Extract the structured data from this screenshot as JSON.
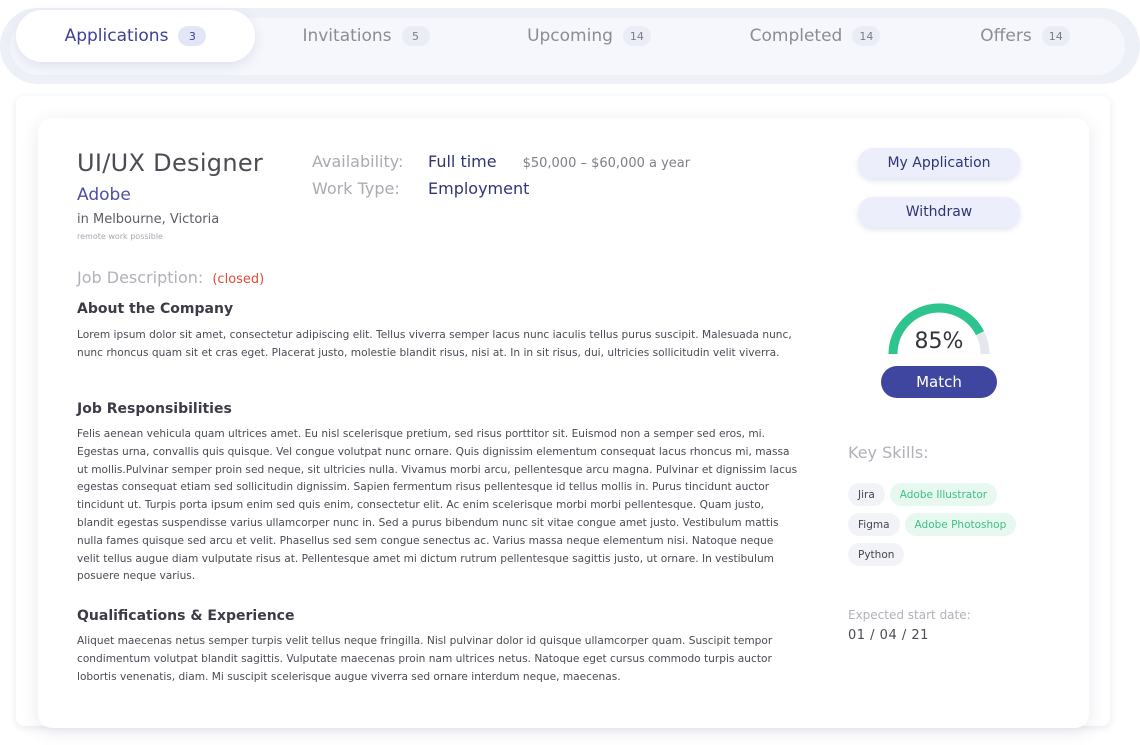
{
  "tabs": [
    {
      "label": "Applications",
      "count": "3"
    },
    {
      "label": "Invitations",
      "count": "5"
    },
    {
      "label": "Upcoming",
      "count": "14"
    },
    {
      "label": "Completed",
      "count": "14"
    },
    {
      "label": "Offers",
      "count": "14"
    }
  ],
  "active_tab": "Applications",
  "job": {
    "title": "UI/UX Designer",
    "company": "Adobe",
    "location": "in Melbourne, Victoria",
    "remote_note": "remote work possible",
    "availability_label": "Availability:",
    "availability_value": "Full time",
    "salary": "$50,000 – $60,000 a year",
    "work_type_label": "Work Type:",
    "work_type_value": "Employment"
  },
  "description": {
    "title": "Job Description:",
    "status": "(closed)",
    "sections": [
      {
        "heading": "About the Company",
        "body": "Lorem ipsum dolor sit amet, consectetur adipiscing elit. Tellus viverra semper lacus nunc iaculis tellus purus suscipit. Malesuada nunc, nunc rhoncus quam sit et cras eget. Placerat justo, molestie blandit risus, nisi at. In in sit risus, dui, ultricies sollicitudin velit viverra."
      },
      {
        "heading": "Job Responsibilities",
        "body": "Felis aenean vehicula quam ultrices amet. Eu nisl scelerisque pretium, sed risus porttitor sit. Euismod non a semper sed eros, mi. Egestas urna, convallis quis quisque. Vel congue volutpat nunc ornare. Quis dignissim elementum consequat lacus rhoncus mi, massa ut mollis.Pulvinar semper proin sed neque, sit ultricies nulla. Vivamus morbi arcu, pellentesque arcu magna. Pulvinar et dignissim lacus egestas consequat etiam sed sollicitudin dignissim. Sapien fermentum risus pellentesque id tellus mollis in. Purus tincidunt auctor tincidunt ut. Turpis porta ipsum enim sed quis enim, consectetur elit. Ac enim scelerisque morbi morbi pellentesque. Quam justo, blandit egestas suspendisse varius ullamcorper nunc in. Sed a purus bibendum nunc sit vitae congue amet justo. Vestibulum mattis nulla fames quisque sed arcu et velit. Phasellus sed sem congue senectus ac. Varius massa neque elementum nisi. Natoque neque velit tellus augue diam vulputate risus at. Pellentesque amet mi dictum rutrum pellentesque sagittis justo, ut ornare. In vestibulum posuere neque varius."
      },
      {
        "heading": "Qualifications & Experience",
        "body": "Aliquet maecenas netus semper turpis velit tellus neque fringilla. Nisl pulvinar dolor id quisque ullamcorper quam. Suscipit tempor condimentum volutpat blandit sagittis. Vulputate maecenas proin nam ultrices netus. Natoque eget cursus commodo turpis auctor lobortis venenatis, diam. Mi suscipit scelerisque augue viverra sed ornare interdum neque, maecenas."
      }
    ]
  },
  "actions": {
    "my_application": "My Application",
    "withdraw": "Withdraw"
  },
  "match": {
    "value_text": "85%",
    "percent": 85,
    "label": "Match",
    "color": "#2ec48d",
    "track_color": "#e6e7ee"
  },
  "skills": {
    "title": "Key Skills:",
    "rows": [
      [
        {
          "name": "Jira",
          "highlight": false
        },
        {
          "name": "Adobe Illustrator",
          "highlight": true
        }
      ],
      [
        {
          "name": "Figma",
          "highlight": false
        },
        {
          "name": "Adobe Photoshop",
          "highlight": true
        }
      ],
      [
        {
          "name": "Python",
          "highlight": false
        }
      ]
    ]
  },
  "start": {
    "label": "Expected start date:",
    "value": "01 / 04 / 21"
  },
  "colors": {
    "accent": "#3f46a0",
    "closed": "#e04a3b",
    "skill_highlight": "#3fbf86"
  }
}
